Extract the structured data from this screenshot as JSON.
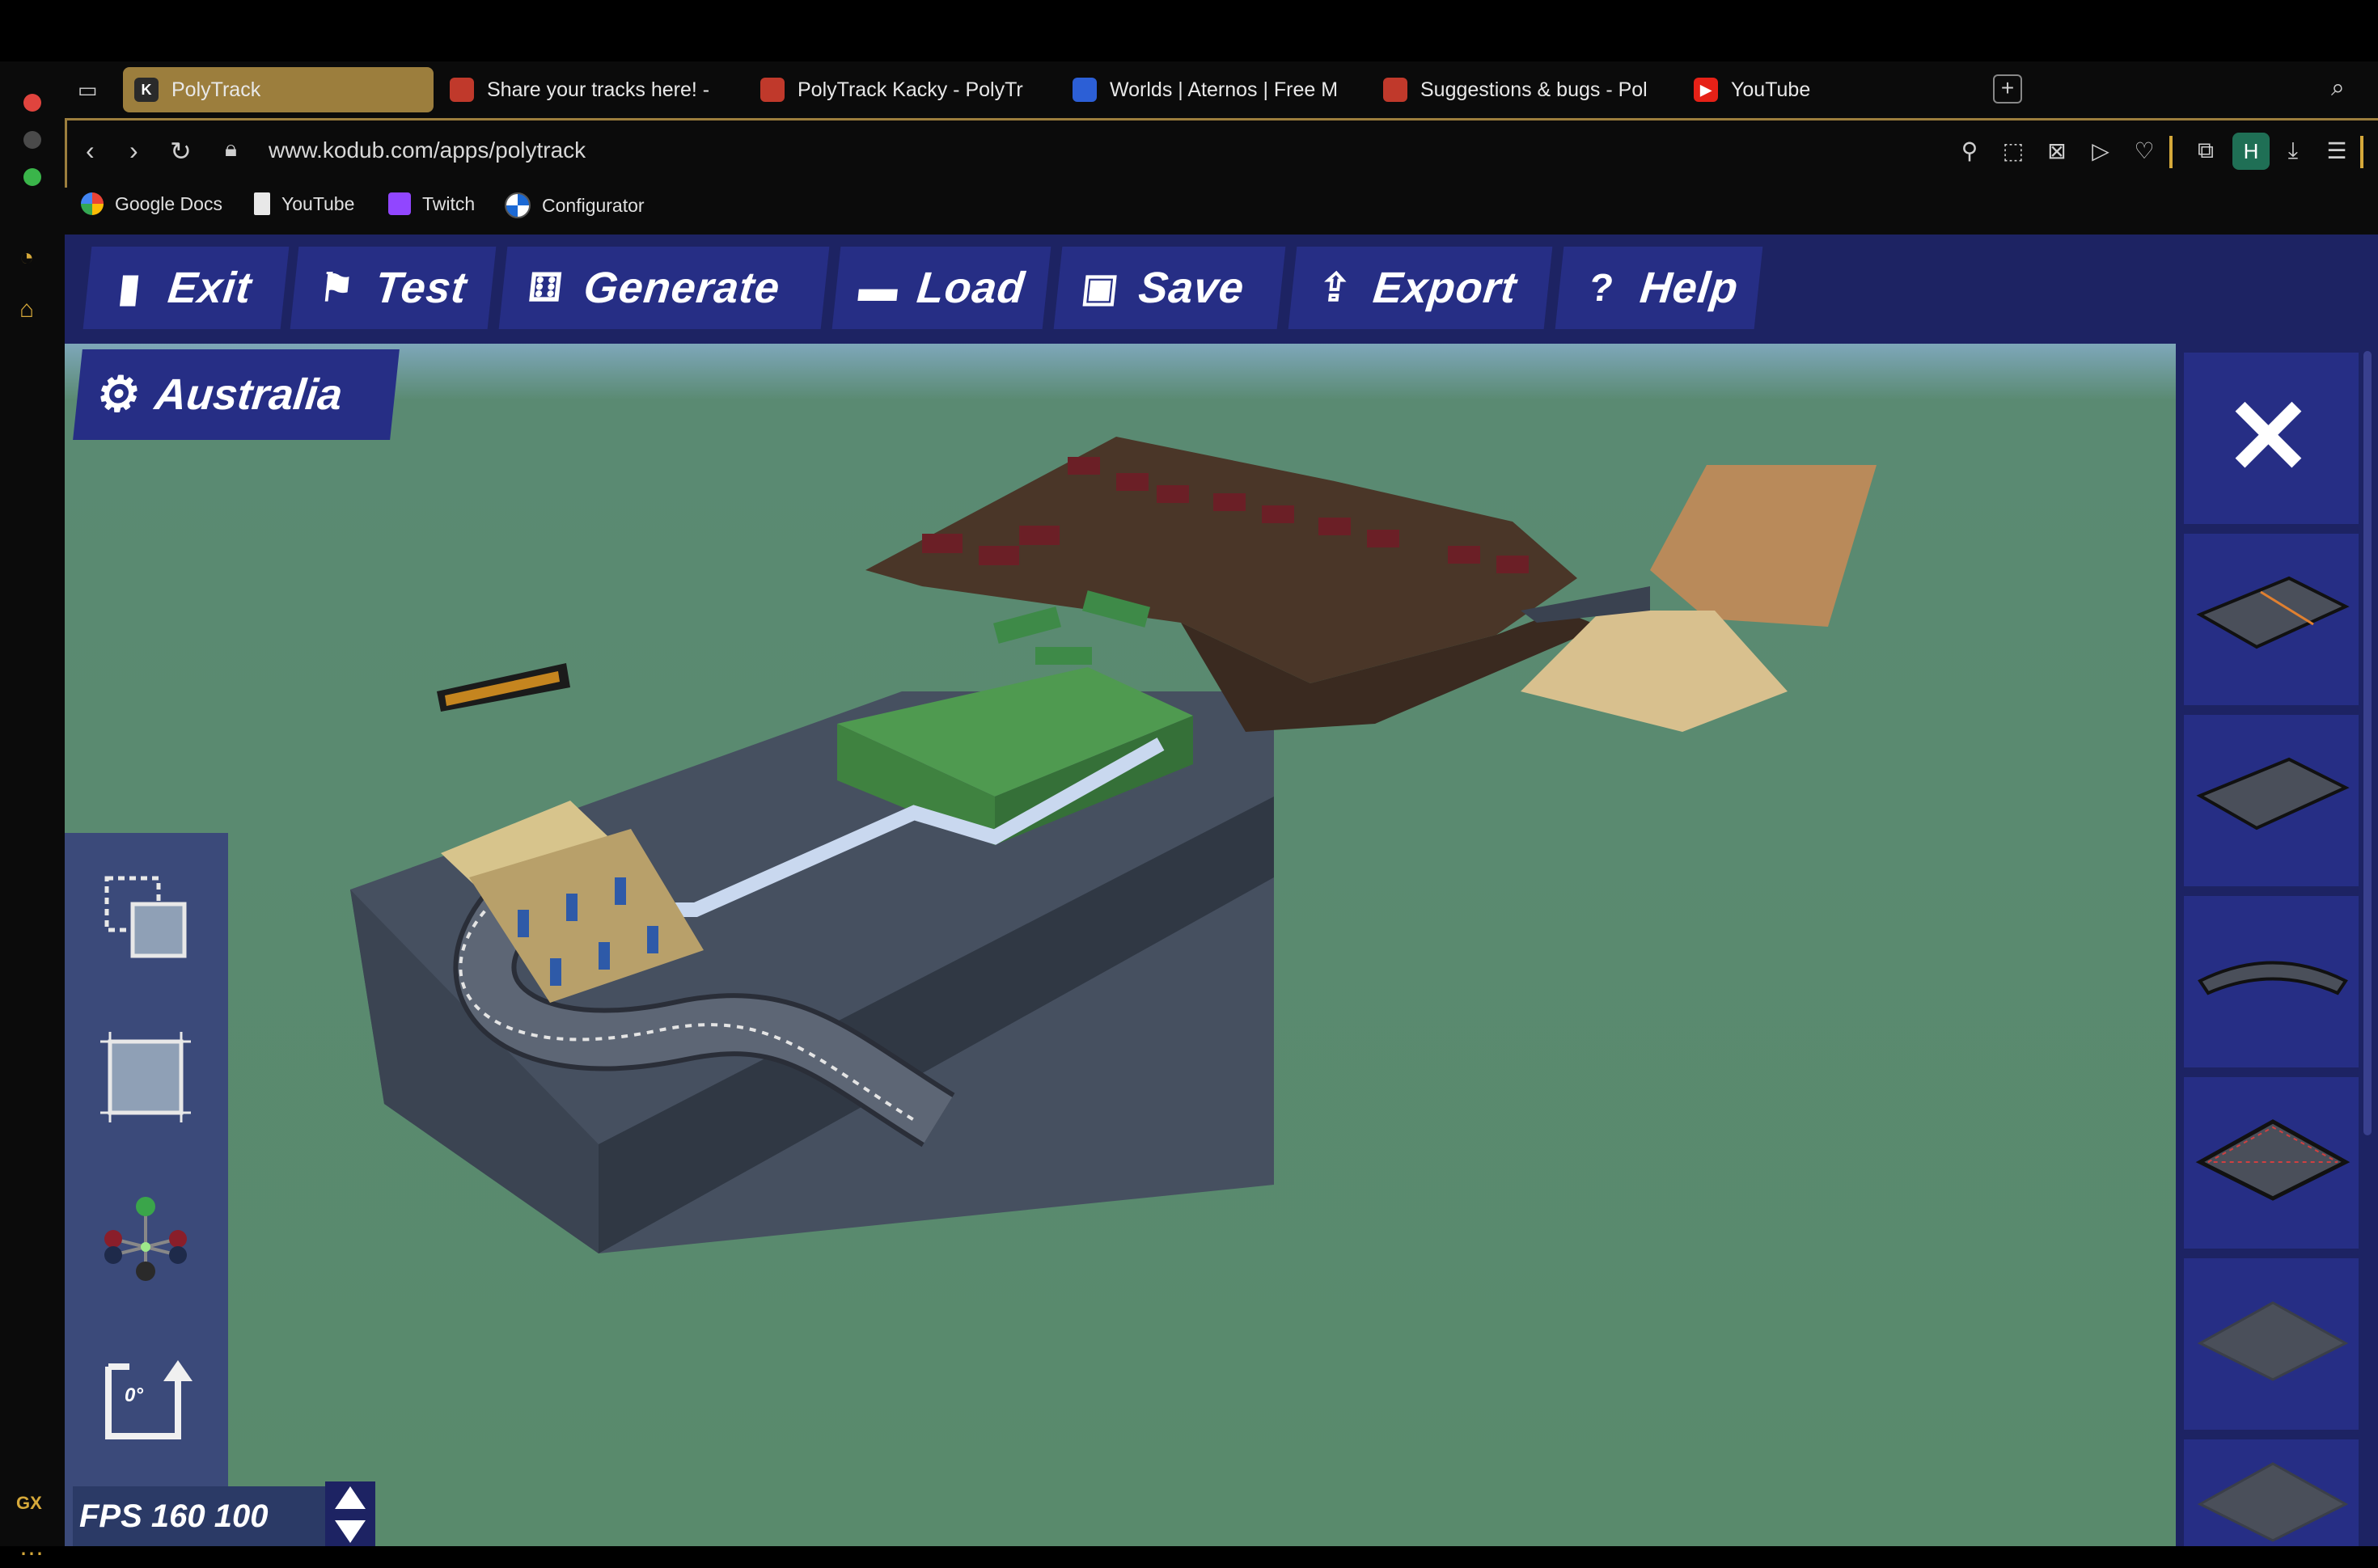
{
  "browser": {
    "tabs": [
      {
        "label": "PolyTrack",
        "favicon": "kodub-icon",
        "color": "#2a2a2a",
        "active": true
      },
      {
        "label": "Share your tracks here! - ",
        "favicon": "forum-icon",
        "color": "#c0392b"
      },
      {
        "label": "PolyTrack Kacky - PolyTr",
        "favicon": "forum-icon",
        "color": "#c0392b"
      },
      {
        "label": "Worlds | Aternos | Free M",
        "favicon": "aternos-icon",
        "color": "#2c5fd6"
      },
      {
        "label": "Suggestions & bugs - Pol",
        "favicon": "forum-icon",
        "color": "#c0392b"
      },
      {
        "label": "YouTube",
        "favicon": "youtube-icon",
        "color": "#e62117"
      }
    ],
    "url": "www.kodub.com/apps/polytrack",
    "bookmarks": [
      {
        "label": "Google Docs",
        "icon": "google-icon"
      },
      {
        "label": "YouTube",
        "icon": "file-icon"
      },
      {
        "label": "Twitch",
        "icon": "twitch-icon"
      },
      {
        "label": "Configurator",
        "icon": "bmw-icon"
      }
    ],
    "profile_initial": "H",
    "sidebar_label": "GX"
  },
  "editor": {
    "menu": [
      {
        "label": "Exit",
        "icon": "door-icon"
      },
      {
        "label": "Test",
        "icon": "flag-icon"
      },
      {
        "label": "Generate",
        "icon": "dice-icon"
      },
      {
        "label": "Load",
        "icon": "folder-icon"
      },
      {
        "label": "Save",
        "icon": "floppy-icon"
      },
      {
        "label": "Export",
        "icon": "share-icon"
      },
      {
        "label": "Help",
        "icon": "help-icon"
      }
    ],
    "track_name": "Australia",
    "tools": [
      "select-icon",
      "area-icon",
      "move-gizmo-icon",
      "rotate-icon"
    ],
    "rotation_label": "0°",
    "stats_text": "FPS 160 100",
    "close_label": "✕",
    "piece_slots": [
      "road-straight-checkpoint",
      "road-straight",
      "road-curve",
      "road-square-border",
      "plain-square",
      "block"
    ],
    "colors": {
      "accent": "#9c7e3d",
      "panel": "#1d2363",
      "button": "#262e85"
    }
  }
}
